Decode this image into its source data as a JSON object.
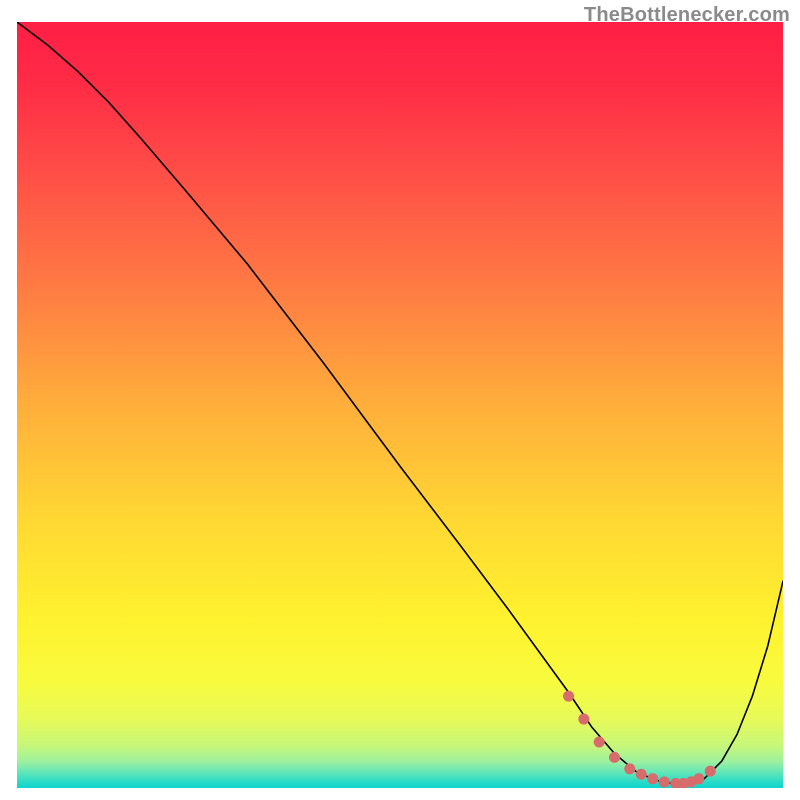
{
  "attribution": "TheBottlenecker.com",
  "chart_data": {
    "type": "line",
    "title": "",
    "xlabel": "",
    "ylabel": "",
    "xlim": [
      0,
      100
    ],
    "ylim": [
      0,
      100
    ],
    "gradient_stops": [
      {
        "offset": 0.0,
        "color": "#ff1f45"
      },
      {
        "offset": 0.08,
        "color": "#ff2b46"
      },
      {
        "offset": 0.2,
        "color": "#ff4f47"
      },
      {
        "offset": 0.35,
        "color": "#ff7c43"
      },
      {
        "offset": 0.5,
        "color": "#ffae3b"
      },
      {
        "offset": 0.65,
        "color": "#ffd833"
      },
      {
        "offset": 0.78,
        "color": "#fff22f"
      },
      {
        "offset": 0.86,
        "color": "#f8fb3d"
      },
      {
        "offset": 0.91,
        "color": "#e7fa58"
      },
      {
        "offset": 0.945,
        "color": "#c6f77a"
      },
      {
        "offset": 0.965,
        "color": "#9ef19e"
      },
      {
        "offset": 0.98,
        "color": "#60e6b9"
      },
      {
        "offset": 0.992,
        "color": "#29dbc7"
      },
      {
        "offset": 1.0,
        "color": "#0fd4cd"
      }
    ],
    "series": [
      {
        "name": "bottleneck-curve",
        "stroke": "#000000",
        "stroke_width": 1.6,
        "x": [
          0.0,
          4.0,
          8.0,
          12.0,
          16.0,
          22.0,
          30.0,
          40.0,
          50.0,
          58.0,
          64.0,
          68.0,
          72.0,
          75.0,
          78.0,
          81.0,
          83.5,
          86.0,
          88.0,
          89.5,
          92.0,
          94.0,
          96.0,
          98.0,
          100.0
        ],
        "y": [
          100.0,
          97.0,
          93.5,
          89.5,
          85.0,
          78.0,
          68.5,
          55.5,
          42.0,
          31.5,
          23.5,
          18.0,
          12.5,
          8.0,
          4.5,
          2.0,
          1.0,
          0.5,
          0.5,
          1.0,
          3.5,
          7.0,
          12.0,
          18.5,
          27.0
        ]
      }
    ],
    "markers": {
      "name": "optimal-zone-markers",
      "color": "#d86b6b",
      "radius": 5.5,
      "x": [
        72.0,
        74.0,
        76.0,
        78.0,
        80.0,
        81.5,
        83.0,
        84.5,
        86.0,
        87.0,
        88.0,
        89.0,
        90.5
      ],
      "y": [
        12.0,
        9.0,
        6.0,
        4.0,
        2.5,
        1.8,
        1.2,
        0.8,
        0.6,
        0.6,
        0.8,
        1.2,
        2.2
      ]
    },
    "grid": false,
    "legend": false,
    "annotations": []
  }
}
